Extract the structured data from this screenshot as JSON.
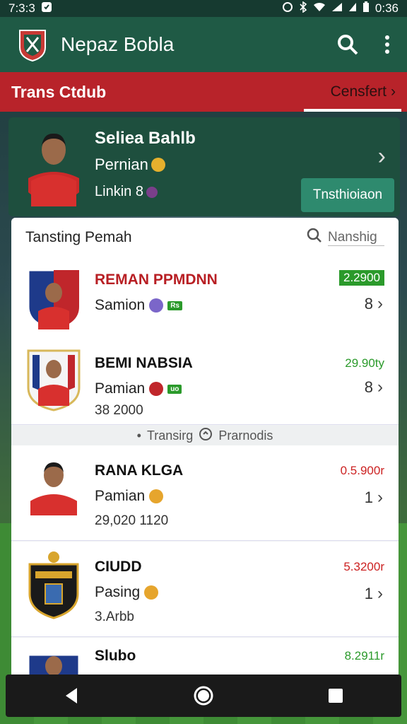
{
  "status_bar": {
    "time": "7:3:3",
    "clock_right": "0:36"
  },
  "app_bar": {
    "title": "Nepaz Bobla"
  },
  "section": {
    "title": "Trans Ctdub",
    "link": "Censfert"
  },
  "profile": {
    "name": "Seliea Bahlb",
    "role": "Pernian",
    "link": "Linkin 8",
    "button": "Tnsthioiaon"
  },
  "list": {
    "title": "Tansting Pemah",
    "search_placeholder": "Nanshig",
    "rows": [
      {
        "name": "REMAN PPMDNN",
        "role": "Samion",
        "tag": "Rs",
        "value": "2.2900",
        "value_color": "#2b9a2b",
        "count": "8"
      },
      {
        "name": "BEMI NABSIA",
        "role": "Pamian",
        "tag": "uo",
        "sub": "38 2000",
        "value": "29.90ty",
        "value_color": "#2b9a2b",
        "count": "8"
      },
      {
        "name": "RANA KLGA",
        "role": "Pamian",
        "sub": "29,020 1120",
        "value": "0.5.900r",
        "value_color": "#c22",
        "count": "1"
      },
      {
        "name": "CIUDD",
        "role": "Pasing",
        "sub": "3.Arbb",
        "value": "5.3200r",
        "value_color": "#c22",
        "count": "1"
      },
      {
        "name": "Slubo",
        "value": "8.2911r",
        "value_color": "#2b9a2b"
      }
    ],
    "divider": {
      "left": "Transirg",
      "right": "Prarnodis"
    }
  },
  "colors": {
    "app_bar": "#1f5a45",
    "section_bar": "#b8232a",
    "profile_card": "#1e4f3e",
    "button": "#2e8a6e"
  }
}
